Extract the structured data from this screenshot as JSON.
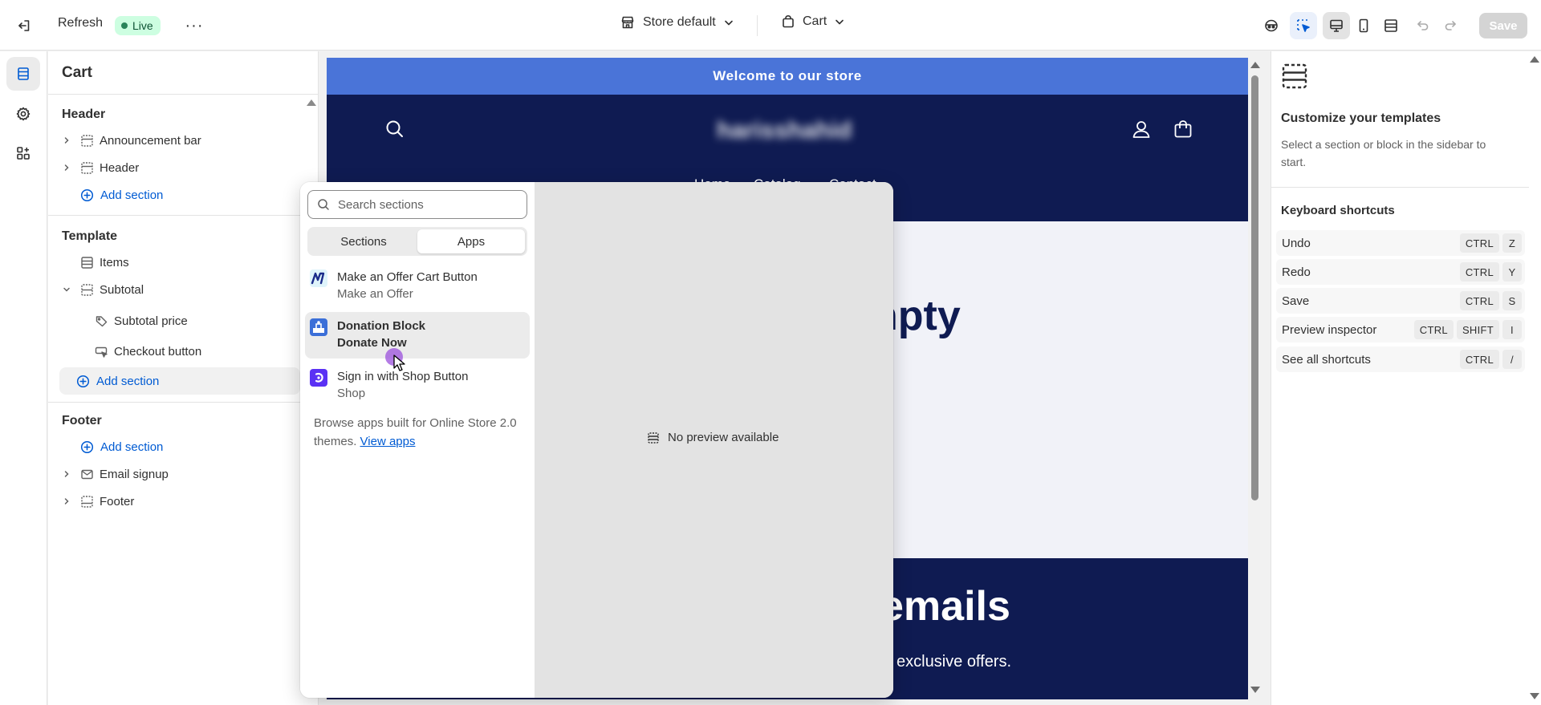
{
  "colors": {
    "accent": "#005bd3",
    "live_bg": "#cdfee1",
    "live_dot": "#29845a",
    "store_navy": "#0f1b52",
    "announcement_blue": "#4a74d8"
  },
  "topbar": {
    "refresh_label": "Refresh",
    "live_badge": "Live",
    "more_label": "···",
    "theme_selector": "Store default",
    "template_selector": "Cart",
    "save_label": "Save"
  },
  "sidebar": {
    "title": "Cart",
    "groups": {
      "header": {
        "label": "Header",
        "items": [
          "Announcement bar",
          "Header"
        ],
        "add_label": "Add section"
      },
      "template": {
        "label": "Template",
        "items": [
          "Items",
          "Subtotal"
        ],
        "subitems": [
          "Subtotal price",
          "Checkout button"
        ],
        "add_label": "Add section"
      },
      "footer": {
        "label": "Footer",
        "add_label": "Add section",
        "items": [
          "Email signup",
          "Footer"
        ]
      }
    }
  },
  "preview": {
    "announcement": "Welcome to our store",
    "store_name": "harisshahid",
    "nav": [
      "Home",
      "Catalog",
      "Contact"
    ],
    "empty_heading_fragment": "npty",
    "newsletter_heading_fragment": "emails",
    "newsletter_sub_fragment": "exclusive offers."
  },
  "picker": {
    "search_placeholder": "Search sections",
    "tabs": [
      "Sections",
      "Apps"
    ],
    "selected_tab": "Apps",
    "apps": [
      {
        "name": "Make an Offer Cart Button",
        "vendor": "Make an Offer",
        "logo_icon": "make-an-offer-logo"
      },
      {
        "name": "Donation Block",
        "vendor": "Donate Now",
        "logo_icon": "donation-block-logo"
      },
      {
        "name": "Sign in with Shop Button",
        "vendor": "Shop",
        "logo_icon": "shop-logo"
      }
    ],
    "browse_text": "Browse apps built for Online Store 2.0 themes.",
    "browse_link": "View apps",
    "no_preview": "No preview available"
  },
  "right_panel": {
    "title": "Customize your templates",
    "description": "Select a section or block in the sidebar to start.",
    "shortcuts_title": "Keyboard shortcuts",
    "shortcuts": [
      {
        "label": "Undo",
        "keys": [
          "CTRL",
          "Z"
        ]
      },
      {
        "label": "Redo",
        "keys": [
          "CTRL",
          "Y"
        ]
      },
      {
        "label": "Save",
        "keys": [
          "CTRL",
          "S"
        ]
      },
      {
        "label": "Preview inspector",
        "keys": [
          "CTRL",
          "SHIFT",
          "I"
        ]
      },
      {
        "label": "See all shortcuts",
        "keys": [
          "CTRL",
          "/"
        ]
      }
    ]
  }
}
